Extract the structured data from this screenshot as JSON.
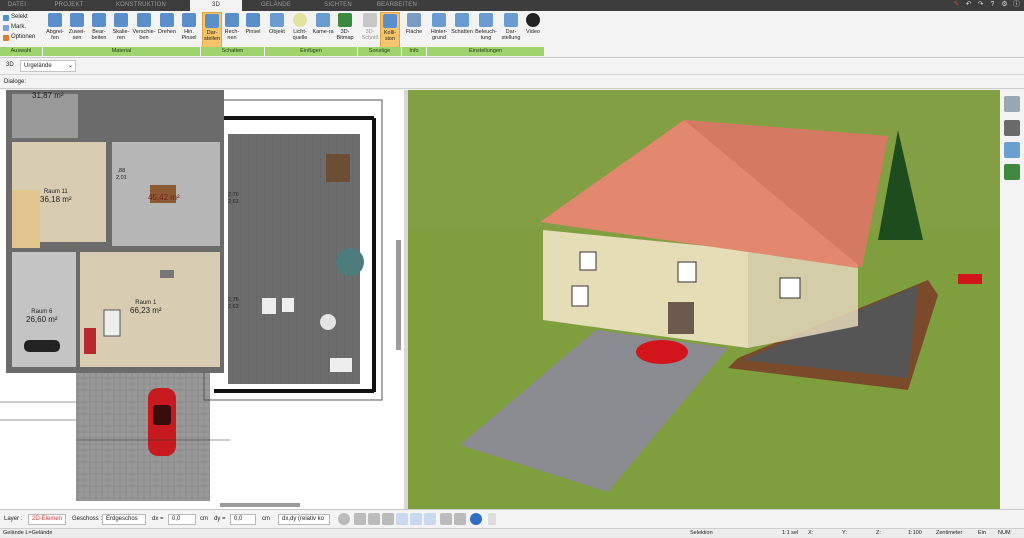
{
  "menubar": {
    "tabs": [
      {
        "label": "DATEI"
      },
      {
        "label": "PROJEKT"
      },
      {
        "label": "KONSTRUKTION"
      },
      {
        "label": "3D"
      },
      {
        "label": "GELÄNDE"
      },
      {
        "label": "SICHTEN"
      },
      {
        "label": "BEARBEITEN"
      }
    ],
    "active_tab": "3D"
  },
  "ribbon": {
    "auswahl": {
      "selekt": "Selekt",
      "mark": "Mark.",
      "optionen": "Optionen",
      "group": "Auswahl"
    },
    "material": {
      "buttons": [
        "Abgrei-fen",
        "Zuwei-sen",
        "Bear-beiten",
        "Skalie-ren",
        "Verschie-ben",
        "Drehen",
        "Hin. Pinsel"
      ],
      "group": "Material"
    },
    "schatten": {
      "buttons": [
        "Dar-stellen",
        "Rech-nen",
        "Pinsel"
      ],
      "group": "Schatten"
    },
    "einfuegen": {
      "buttons": [
        "Objekt",
        "Licht-quelle",
        "Kame-ra",
        "3D-Bitmap"
      ],
      "group": "Einfügen"
    },
    "sonstige": {
      "buttons": [
        "3D-Schnitt",
        "Kolli-sion"
      ],
      "group": "Sonstige"
    },
    "info": {
      "buttons": [
        "Fläche"
      ],
      "group": "Info"
    },
    "einstellungen": {
      "buttons": [
        "Hinter-grund",
        "Schatten",
        "Beleuch-tung",
        "Dar-stellung",
        "Video"
      ],
      "group": "Einstellungen"
    },
    "accent": "#9fd36d",
    "active_button_color": "#f6c46b"
  },
  "optbar": {
    "mode": "3D",
    "terrain_select": "Urgelände"
  },
  "dialog_bar": {
    "label": "Dialoge:"
  },
  "plan": {
    "rooms": [
      {
        "name": "",
        "area": "31,87 m²"
      },
      {
        "name": "Raum 11",
        "area": "36,18 m²"
      },
      {
        "name": "",
        "area": "45,42 m²"
      },
      {
        "name": "Raum 6",
        "area": "26,60 m²"
      },
      {
        "name": "Raum 1",
        "area": "66,23 m²"
      }
    ],
    "dims": [
      "2,76",
      "2,63",
      "2,76",
      "2,63",
      ",88",
      "2,01"
    ]
  },
  "bottom_toolbar": {
    "layer_label": "Layer :",
    "layer_value": "2D-Elemen",
    "geschoss_label": "Geschoss :",
    "geschoss_value": "Erdgeschos",
    "dx_label": "dx =",
    "dx_value": "0,0",
    "dy_label": "dy =",
    "dy_value": "0,0",
    "unit": "cm",
    "mode_text": "dx,dy (relativ ko"
  },
  "statusbar": {
    "left": "Gelände L=Gelände",
    "selektion": "Selektion",
    "scale_sel": "1:1 sel",
    "x_label": "X:",
    "y_label": "Y:",
    "z_label": "Z:",
    "scale": "1:100",
    "unit": "Zentimeter",
    "ein": "Ein",
    "num": "NUM"
  },
  "colors": {
    "grass": "#7f9e3e",
    "roof": "#e2886f",
    "driveway": "#8b8b92",
    "car": "#d1151b"
  }
}
